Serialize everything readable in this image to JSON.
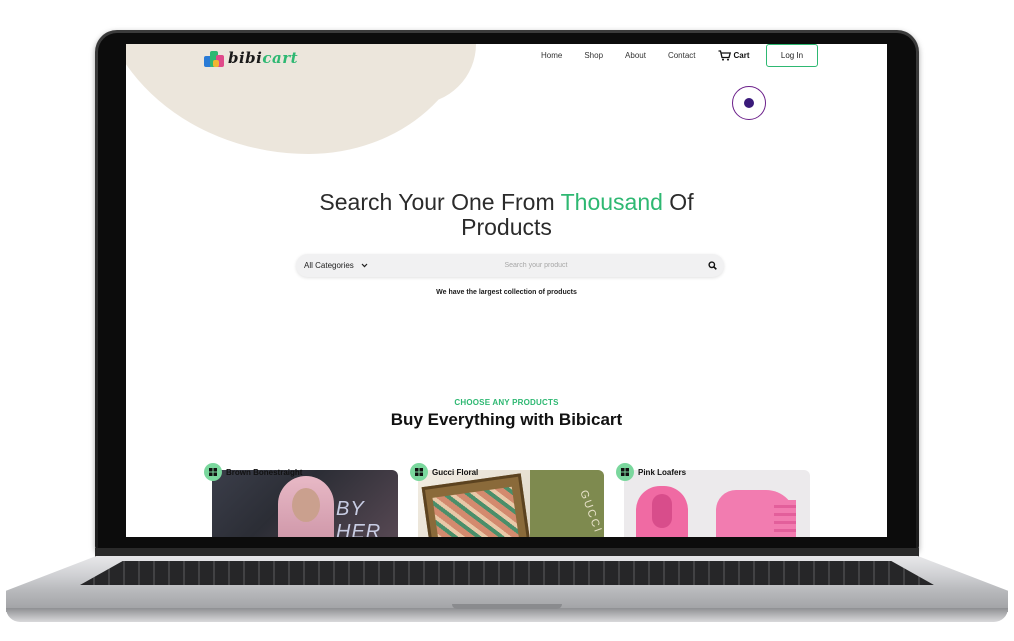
{
  "brand": {
    "name_part1": "bibi",
    "name_part2": "cart"
  },
  "nav": {
    "items": [
      {
        "label": "Home"
      },
      {
        "label": "Shop"
      },
      {
        "label": "About"
      },
      {
        "label": "Contact"
      }
    ],
    "cart_label": "Cart",
    "login_label": "Log In"
  },
  "hero": {
    "title_before": "Search Your One From ",
    "title_accent": "Thousand",
    "title_after": " Of",
    "title_line2": "Products",
    "subtitle": "We have the largest collection of products"
  },
  "search": {
    "category": "All Categories",
    "placeholder": "Search your product"
  },
  "products_section": {
    "eyebrow": "CHOOSE ANY PRODUCTS",
    "heading": "Buy Everything with Bibicart",
    "cards": [
      {
        "label": "Brown Bonestraight"
      },
      {
        "label": "Gucci Floral"
      },
      {
        "label": "Pink Loafers"
      }
    ]
  },
  "colors": {
    "accent": "#2eb872",
    "badge": "#7ad79d",
    "cursor": "#6b1f8a"
  },
  "icons": {
    "cart": "cart-icon",
    "search": "search-icon",
    "dropdown": "chevron-down-icon",
    "card": "grid-icon"
  }
}
